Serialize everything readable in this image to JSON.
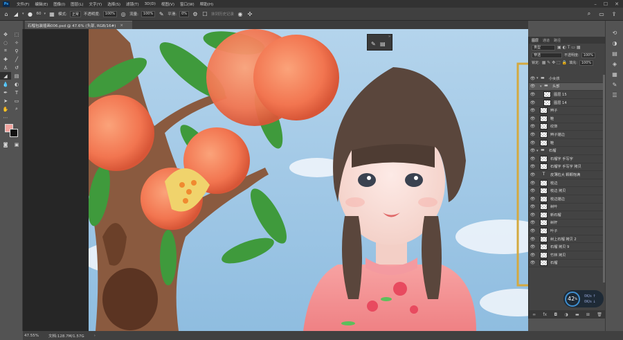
{
  "menubar": {
    "logo": "Ps",
    "items": [
      "文件(F)",
      "编辑(E)",
      "图像(I)",
      "图层(L)",
      "文字(Y)",
      "选择(S)",
      "滤镜(T)",
      "3D(D)",
      "视图(V)",
      "窗口(W)",
      "帮助(H)"
    ],
    "controls": [
      "–",
      "☐",
      "✕"
    ]
  },
  "options": {
    "brush_size": "60",
    "mode_label": "模式:",
    "mode_value": "正常",
    "opacity_label": "不透明度:",
    "opacity_value": "100%",
    "flow_label": "流量:",
    "flow_value": "100%",
    "smooth_label": "平滑:",
    "smooth_value": "0%",
    "erase_history": "抹到历史记录"
  },
  "document": {
    "tab_title": "石榴包装插画006.psd @ 47.6% (头部, RGB/16#)",
    "close": "×"
  },
  "status": {
    "zoom": "47.55%",
    "doc_info": "文档:128.7M/1.57G"
  },
  "layers_panel": {
    "tabs": [
      "图层",
      "通道",
      "路径"
    ],
    "filter_kind": "类型",
    "blend_mode": "穿透",
    "opacity_label": "不透明度:",
    "opacity_value": "100%",
    "lock_label": "锁定:",
    "fill_label": "填充:",
    "fill_value": "100%",
    "layers": [
      {
        "name": "小女孩",
        "type": "group",
        "indent": 0
      },
      {
        "name": "头部",
        "type": "group",
        "indent": 1,
        "selected": true
      },
      {
        "name": "图层 15",
        "type": "layer",
        "indent": 2
      },
      {
        "name": "图层 14",
        "type": "layer",
        "indent": 2
      },
      {
        "name": "辫子",
        "type": "layer",
        "indent": 1
      },
      {
        "name": "鞋",
        "type": "layer",
        "indent": 1
      },
      {
        "name": "纹饰",
        "type": "layer",
        "indent": 1
      },
      {
        "name": "辫子描边",
        "type": "layer",
        "indent": 1
      },
      {
        "name": "鞋",
        "type": "layer",
        "indent": 1
      },
      {
        "name": "石榴",
        "type": "group",
        "indent": 0
      },
      {
        "name": "石榴字 手写字",
        "type": "layer",
        "indent": 1
      },
      {
        "name": "石榴字 手写字 拷贝",
        "type": "layer",
        "indent": 1
      },
      {
        "name": "皮薄粒大 颗颗饱满",
        "type": "text",
        "indent": 1
      },
      {
        "name": "枝边",
        "type": "layer",
        "indent": 1
      },
      {
        "name": "枝边 拷贝",
        "type": "layer",
        "indent": 1
      },
      {
        "name": "枝边描边",
        "type": "layer",
        "indent": 1
      },
      {
        "name": "树叶",
        "type": "layer",
        "indent": 1
      },
      {
        "name": "新石榴",
        "type": "layer",
        "indent": 1
      },
      {
        "name": "树杆",
        "type": "layer",
        "indent": 1
      },
      {
        "name": "叶子",
        "type": "layer",
        "indent": 1
      },
      {
        "name": "树上石榴 拷贝 2",
        "type": "layer",
        "indent": 1
      },
      {
        "name": "石榴 拷贝 9",
        "type": "layer",
        "indent": 1
      },
      {
        "name": "竹林 拷贝",
        "type": "layer",
        "indent": 1
      },
      {
        "name": "石榴",
        "type": "layer",
        "indent": 1
      }
    ],
    "footer_icons": [
      "link-icon",
      "fx-icon",
      "mask-icon",
      "adjustment-icon",
      "folder-icon",
      "new-layer-icon",
      "trash-icon"
    ]
  },
  "gauge": {
    "value": "42",
    "unit": "%",
    "up": "0",
    "down": "0",
    "up_unit": "K/s",
    "down_unit": "K/s"
  }
}
